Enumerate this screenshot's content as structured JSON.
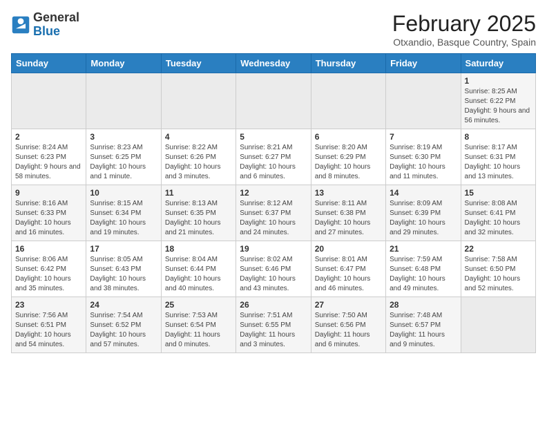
{
  "header": {
    "logo_general": "General",
    "logo_blue": "Blue",
    "month_title": "February 2025",
    "subtitle": "Otxandio, Basque Country, Spain"
  },
  "weekdays": [
    "Sunday",
    "Monday",
    "Tuesday",
    "Wednesday",
    "Thursday",
    "Friday",
    "Saturday"
  ],
  "weeks": [
    [
      {
        "day": "",
        "empty": true
      },
      {
        "day": "",
        "empty": true
      },
      {
        "day": "",
        "empty": true
      },
      {
        "day": "",
        "empty": true
      },
      {
        "day": "",
        "empty": true
      },
      {
        "day": "",
        "empty": true
      },
      {
        "day": "1",
        "sunrise": "8:25 AM",
        "sunset": "6:22 PM",
        "daylight": "9 hours and 56 minutes."
      }
    ],
    [
      {
        "day": "2",
        "sunrise": "8:24 AM",
        "sunset": "6:23 PM",
        "daylight": "9 hours and 58 minutes."
      },
      {
        "day": "3",
        "sunrise": "8:23 AM",
        "sunset": "6:25 PM",
        "daylight": "10 hours and 1 minute."
      },
      {
        "day": "4",
        "sunrise": "8:22 AM",
        "sunset": "6:26 PM",
        "daylight": "10 hours and 3 minutes."
      },
      {
        "day": "5",
        "sunrise": "8:21 AM",
        "sunset": "6:27 PM",
        "daylight": "10 hours and 6 minutes."
      },
      {
        "day": "6",
        "sunrise": "8:20 AM",
        "sunset": "6:29 PM",
        "daylight": "10 hours and 8 minutes."
      },
      {
        "day": "7",
        "sunrise": "8:19 AM",
        "sunset": "6:30 PM",
        "daylight": "10 hours and 11 minutes."
      },
      {
        "day": "8",
        "sunrise": "8:17 AM",
        "sunset": "6:31 PM",
        "daylight": "10 hours and 13 minutes."
      }
    ],
    [
      {
        "day": "9",
        "sunrise": "8:16 AM",
        "sunset": "6:33 PM",
        "daylight": "10 hours and 16 minutes."
      },
      {
        "day": "10",
        "sunrise": "8:15 AM",
        "sunset": "6:34 PM",
        "daylight": "10 hours and 19 minutes."
      },
      {
        "day": "11",
        "sunrise": "8:13 AM",
        "sunset": "6:35 PM",
        "daylight": "10 hours and 21 minutes."
      },
      {
        "day": "12",
        "sunrise": "8:12 AM",
        "sunset": "6:37 PM",
        "daylight": "10 hours and 24 minutes."
      },
      {
        "day": "13",
        "sunrise": "8:11 AM",
        "sunset": "6:38 PM",
        "daylight": "10 hours and 27 minutes."
      },
      {
        "day": "14",
        "sunrise": "8:09 AM",
        "sunset": "6:39 PM",
        "daylight": "10 hours and 29 minutes."
      },
      {
        "day": "15",
        "sunrise": "8:08 AM",
        "sunset": "6:41 PM",
        "daylight": "10 hours and 32 minutes."
      }
    ],
    [
      {
        "day": "16",
        "sunrise": "8:06 AM",
        "sunset": "6:42 PM",
        "daylight": "10 hours and 35 minutes."
      },
      {
        "day": "17",
        "sunrise": "8:05 AM",
        "sunset": "6:43 PM",
        "daylight": "10 hours and 38 minutes."
      },
      {
        "day": "18",
        "sunrise": "8:04 AM",
        "sunset": "6:44 PM",
        "daylight": "10 hours and 40 minutes."
      },
      {
        "day": "19",
        "sunrise": "8:02 AM",
        "sunset": "6:46 PM",
        "daylight": "10 hours and 43 minutes."
      },
      {
        "day": "20",
        "sunrise": "8:01 AM",
        "sunset": "6:47 PM",
        "daylight": "10 hours and 46 minutes."
      },
      {
        "day": "21",
        "sunrise": "7:59 AM",
        "sunset": "6:48 PM",
        "daylight": "10 hours and 49 minutes."
      },
      {
        "day": "22",
        "sunrise": "7:58 AM",
        "sunset": "6:50 PM",
        "daylight": "10 hours and 52 minutes."
      }
    ],
    [
      {
        "day": "23",
        "sunrise": "7:56 AM",
        "sunset": "6:51 PM",
        "daylight": "10 hours and 54 minutes."
      },
      {
        "day": "24",
        "sunrise": "7:54 AM",
        "sunset": "6:52 PM",
        "daylight": "10 hours and 57 minutes."
      },
      {
        "day": "25",
        "sunrise": "7:53 AM",
        "sunset": "6:54 PM",
        "daylight": "11 hours and 0 minutes."
      },
      {
        "day": "26",
        "sunrise": "7:51 AM",
        "sunset": "6:55 PM",
        "daylight": "11 hours and 3 minutes."
      },
      {
        "day": "27",
        "sunrise": "7:50 AM",
        "sunset": "6:56 PM",
        "daylight": "11 hours and 6 minutes."
      },
      {
        "day": "28",
        "sunrise": "7:48 AM",
        "sunset": "6:57 PM",
        "daylight": "11 hours and 9 minutes."
      },
      {
        "day": "",
        "empty": true
      }
    ]
  ]
}
